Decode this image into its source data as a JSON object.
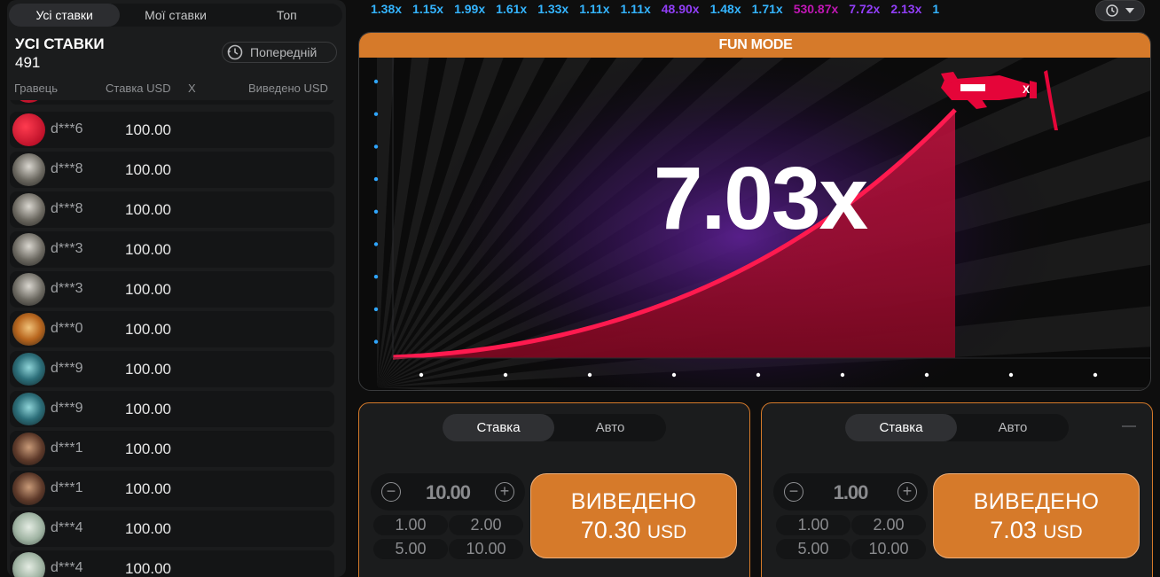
{
  "left_tabs": [
    "Усі ставки",
    "Мої ставки",
    "Топ"
  ],
  "bets_header": {
    "title": "УСІ СТАВКИ",
    "count": "491",
    "previous_label": "Попередній"
  },
  "columns": {
    "player": "Гравець",
    "bet": "Ставка USD",
    "x": "X",
    "cashout": "Виведено USD"
  },
  "rows": [
    {
      "player": "d***6",
      "amount": "100.00",
      "avatar": "dice-avatar"
    },
    {
      "player": "d***8",
      "amount": "100.00",
      "avatar": "pilot-avatar"
    },
    {
      "player": "d***8",
      "amount": "100.00",
      "avatar": "pilot-avatar"
    },
    {
      "player": "d***3",
      "amount": "100.00",
      "avatar": "pilot-avatar"
    },
    {
      "player": "d***3",
      "amount": "100.00",
      "avatar": "pilot-avatar"
    },
    {
      "player": "d***0",
      "amount": "100.00",
      "avatar": "tiger-avatar"
    },
    {
      "player": "d***9",
      "amount": "100.00",
      "avatar": "hooded-avatar"
    },
    {
      "player": "d***9",
      "amount": "100.00",
      "avatar": "hooded-avatar"
    },
    {
      "player": "d***1",
      "amount": "100.00",
      "avatar": "portrait-avatar"
    },
    {
      "player": "d***1",
      "amount": "100.00",
      "avatar": "portrait-avatar"
    },
    {
      "player": "d***4",
      "amount": "100.00",
      "avatar": "money-avatar"
    },
    {
      "player": "d***4",
      "amount": "100.00",
      "avatar": "money-avatar"
    }
  ],
  "history": [
    {
      "value": "1.38x",
      "color": "#34b4ff"
    },
    {
      "value": "1.15x",
      "color": "#34b4ff"
    },
    {
      "value": "1.99x",
      "color": "#34b4ff"
    },
    {
      "value": "1.61x",
      "color": "#34b4ff"
    },
    {
      "value": "1.33x",
      "color": "#34b4ff"
    },
    {
      "value": "1.11x",
      "color": "#34b4ff"
    },
    {
      "value": "1.11x",
      "color": "#34b4ff"
    },
    {
      "value": "48.90x",
      "color": "#913ef8"
    },
    {
      "value": "1.48x",
      "color": "#34b4ff"
    },
    {
      "value": "1.71x",
      "color": "#34b4ff"
    },
    {
      "value": "530.87x",
      "color": "#c017b4"
    },
    {
      "value": "7.72x",
      "color": "#913ef8"
    },
    {
      "value": "2.13x",
      "color": "#913ef8"
    },
    {
      "value": "1",
      "color": "#34b4ff"
    }
  ],
  "game": {
    "mode_label": "FUN MODE",
    "multiplier": "7.03x",
    "curve_color": "#e50539"
  },
  "bet_panels": [
    {
      "tabs": [
        "Ставка",
        "Авто"
      ],
      "amount": "10.00",
      "quick": [
        "1.00",
        "2.00",
        "5.00",
        "10.00"
      ],
      "cashout_label": "ВИВЕДЕНО",
      "cashout_value": "70.30",
      "currency": "USD"
    },
    {
      "tabs": [
        "Ставка",
        "Авто"
      ],
      "amount": "1.00",
      "quick": [
        "1.00",
        "2.00",
        "5.00",
        "10.00"
      ],
      "cashout_label": "ВИВЕДЕНО",
      "cashout_value": "7.03",
      "currency": "USD"
    }
  ],
  "colors": {
    "accent": "#d67a2a",
    "panel": "#1b1c1d",
    "curve": "#e50539"
  }
}
